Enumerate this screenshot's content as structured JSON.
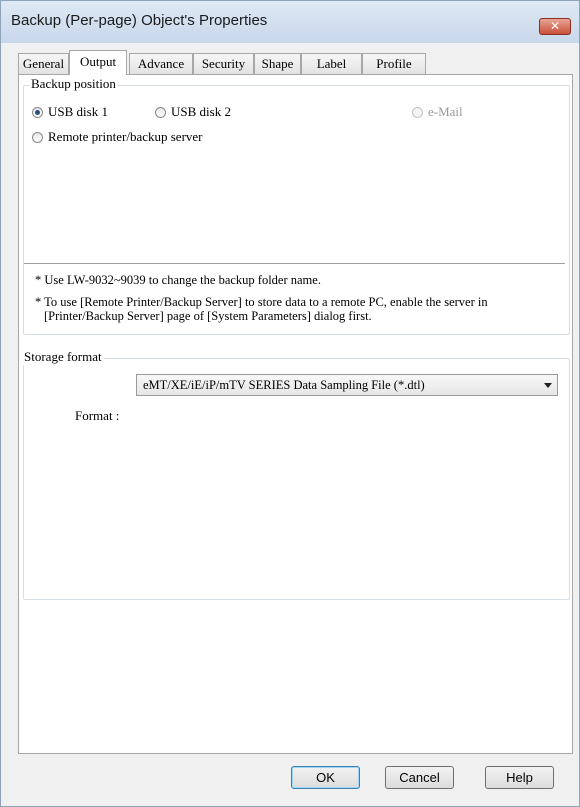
{
  "window": {
    "title": "Backup (Per-page) Object's Properties",
    "close_symbol": "✕"
  },
  "tabs": [
    {
      "label": "General"
    },
    {
      "label": "Output",
      "active": true
    },
    {
      "label": "Advance"
    },
    {
      "label": "Security"
    },
    {
      "label": "Shape"
    },
    {
      "label": "Label"
    },
    {
      "label": "Profile"
    }
  ],
  "backup_position": {
    "legend": "Backup position",
    "options": {
      "usb1": {
        "label": "USB disk 1",
        "checked": true
      },
      "usb2": {
        "label": "USB disk 2",
        "checked": false
      },
      "email": {
        "label": "e-Mail",
        "checked": false,
        "disabled": true
      },
      "remote": {
        "label": "Remote printer/backup server",
        "checked": false
      }
    },
    "note1": "* Use LW-9032~9039 to change the backup folder name.",
    "note2_line1": "* To use [Remote Printer/Backup Server] to store data to a remote PC, enable the server in",
    "note2_line2": "[Printer/Backup Server] page of [System Parameters] dialog first."
  },
  "storage_format": {
    "legend": "Storage format",
    "format_label": "Format :",
    "format_value": "eMT/XE/iE/iP/mTV SERIES Data Sampling File (*.dtl)"
  },
  "buttons": {
    "ok": "OK",
    "cancel": "Cancel",
    "help": "Help"
  }
}
